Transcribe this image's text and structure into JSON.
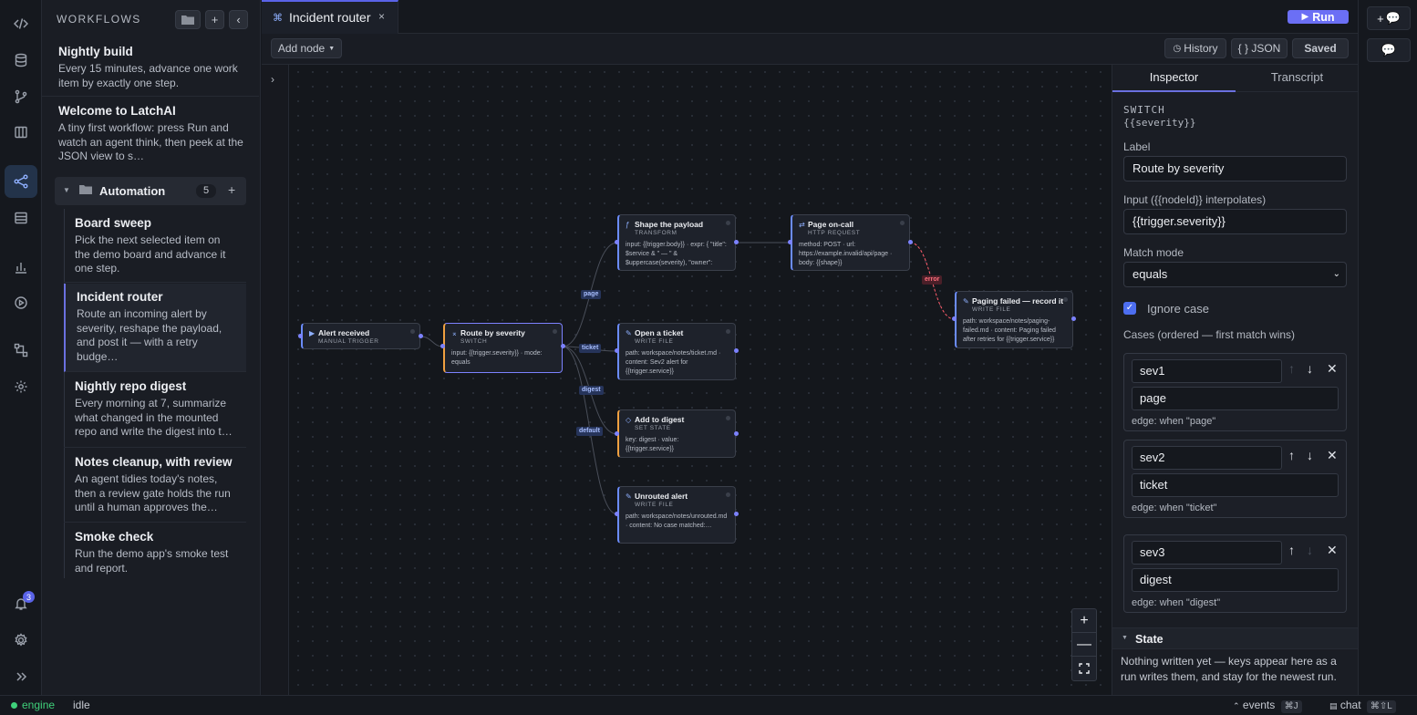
{
  "sidebar": {
    "title": "WORKFLOWS",
    "items": [
      {
        "title": "Nightly build",
        "desc": "Every 15 minutes, advance one work item by exactly one step."
      },
      {
        "title": "Welcome to LatchAI",
        "desc": "A tiny first workflow: press Run and watch an agent think, then peek at the JSON view to s…"
      }
    ],
    "folder": {
      "name": "Automation",
      "count": "5"
    },
    "folder_items": [
      {
        "title": "Board sweep",
        "desc": "Pick the next selected item on the demo board and advance it one step."
      },
      {
        "title": "Incident router",
        "desc": "Route an incoming alert by severity, reshape the payload, and post it — with a retry budge…"
      },
      {
        "title": "Nightly repo digest",
        "desc": "Every morning at 7, summarize what changed in the mounted repo and write the digest into t…"
      },
      {
        "title": "Notes cleanup, with review",
        "desc": "An agent tidies today's notes, then a review gate holds the run until a human approves the…"
      },
      {
        "title": "Smoke check",
        "desc": "Run the demo app's smoke test and report."
      }
    ]
  },
  "rail": {
    "notif_count": "3"
  },
  "tab": {
    "label": "Incident router",
    "close": "×"
  },
  "toolbar": {
    "run": "Run",
    "add_node": "Add node",
    "history": "History",
    "json": "{ } JSON",
    "saved": "Saved"
  },
  "nodes": {
    "alert": {
      "title": "Alert received",
      "type": "MANUAL TRIGGER"
    },
    "route": {
      "title": "Route by severity",
      "type": "SWITCH",
      "body": "input: {{trigger.severity}} · mode: equals"
    },
    "shape": {
      "title": "Shape the payload",
      "type": "TRANSFORM",
      "body": "input: {{trigger.body}} · expr: { \"title\": $service & \" — \" & $uppercase(severity), \"owner\":"
    },
    "page": {
      "title": "Page on-call",
      "type": "HTTP REQUEST",
      "body": "method: POST · url: https://example.invalid/api/page · body: {{shape}}"
    },
    "paging": {
      "title": "Paging failed — record it",
      "type": "WRITE FILE",
      "body": "path: workspace/notes/paging-failed.md · content: Paging failed after retries for {{trigger.service}}"
    },
    "ticket": {
      "title": "Open a ticket",
      "type": "WRITE FILE",
      "body": "path: workspace/notes/ticket.md · content: Sev2 alert for {{trigger.service}}"
    },
    "digest": {
      "title": "Add to digest",
      "type": "SET STATE",
      "body": "key: digest · value: {{trigger.service}}"
    },
    "unrouted": {
      "title": "Unrouted alert",
      "type": "WRITE FILE",
      "body": "path: workspace/notes/unrouted.md · content: No case matched:…"
    }
  },
  "edges": {
    "page": "page",
    "ticket": "ticket",
    "digest": "digest",
    "default": "default",
    "error": "error"
  },
  "inspector": {
    "tabs": [
      "Inspector",
      "Transcript"
    ],
    "node_type": "SWITCH",
    "node_expr": "{{severity}}",
    "label_label": "Label",
    "label_value": "Route by severity",
    "input_label": "Input ({{nodeId}} interpolates)",
    "input_value": "{{trigger.severity}}",
    "match_label": "Match mode",
    "match_value": "equals",
    "ignore_case": "Ignore case",
    "cases_label": "Cases (ordered — first match wins)",
    "cases": [
      {
        "key": "sev1",
        "value": "page",
        "edge": "edge: when \"page\""
      },
      {
        "key": "sev2",
        "value": "ticket",
        "edge": "edge: when \"ticket\""
      },
      {
        "key": "sev3",
        "value": "digest",
        "edge": "edge: when \"digest\""
      }
    ],
    "state_title": "State",
    "state_text": "Nothing written yet — keys appear here as a run writes them, and stay for the newest run."
  },
  "statusbar": {
    "engine": "engine",
    "status": "idle",
    "events": "events",
    "events_kbd": "⌘J",
    "chat": "chat",
    "chat_kbd": "⌘⇧L"
  }
}
